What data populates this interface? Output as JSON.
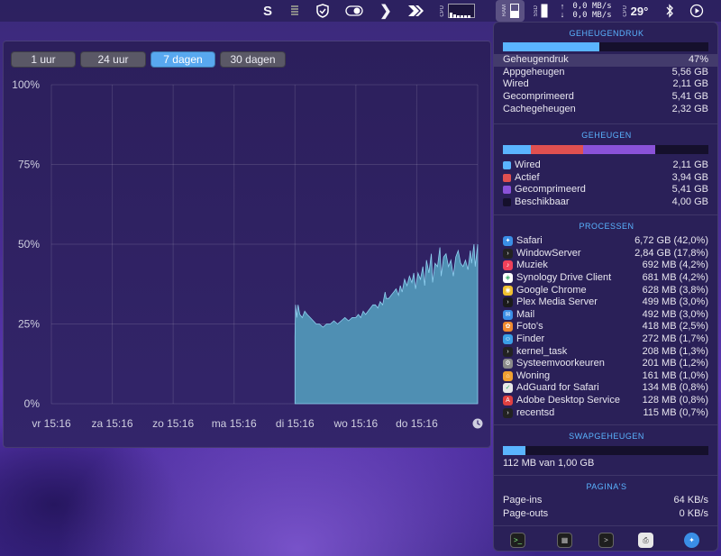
{
  "menubar": {
    "net_up": "0,0 MB/s",
    "net_down": "0,0 MB/s",
    "temperature": "29°"
  },
  "chart_window": {
    "ranges": [
      "1 uur",
      "24 uur",
      "7 dagen",
      "30 dagen"
    ],
    "selected_range": "7 dagen"
  },
  "chart_data": {
    "type": "area",
    "y_ticks": [
      "100%",
      "75%",
      "50%",
      "25%",
      "0%"
    ],
    "x_ticks": [
      "vr 15:16",
      "za 15:16",
      "zo 15:16",
      "ma 15:16",
      "di 15:16",
      "wo 15:16",
      "do 15:16"
    ],
    "ylim": [
      0,
      100
    ],
    "x_range_days": [
      0,
      7
    ],
    "series": [
      {
        "color": "#4f8fb3",
        "points": [
          [
            4.0,
            0
          ],
          [
            4.0,
            21
          ],
          [
            4.01,
            31
          ],
          [
            4.03,
            27
          ],
          [
            4.05,
            31
          ],
          [
            4.08,
            28
          ],
          [
            4.12,
            27
          ],
          [
            4.16,
            29
          ],
          [
            4.2,
            28
          ],
          [
            4.25,
            27
          ],
          [
            4.3,
            26
          ],
          [
            4.35,
            25
          ],
          [
            4.4,
            25
          ],
          [
            4.46,
            24
          ],
          [
            4.52,
            25
          ],
          [
            4.58,
            25
          ],
          [
            4.64,
            26
          ],
          [
            4.7,
            25
          ],
          [
            4.76,
            26
          ],
          [
            4.82,
            27
          ],
          [
            4.88,
            26
          ],
          [
            4.94,
            27
          ],
          [
            5.0,
            27
          ],
          [
            5.04,
            28
          ],
          [
            5.08,
            27
          ],
          [
            5.12,
            29
          ],
          [
            5.16,
            28
          ],
          [
            5.2,
            29
          ],
          [
            5.24,
            30
          ],
          [
            5.28,
            31
          ],
          [
            5.32,
            31
          ],
          [
            5.36,
            30
          ],
          [
            5.4,
            32
          ],
          [
            5.44,
            31
          ],
          [
            5.48,
            35
          ],
          [
            5.5,
            33
          ],
          [
            5.54,
            33
          ],
          [
            5.58,
            34
          ],
          [
            5.62,
            35
          ],
          [
            5.66,
            36
          ],
          [
            5.7,
            34
          ],
          [
            5.73,
            37
          ],
          [
            5.76,
            35
          ],
          [
            5.8,
            39
          ],
          [
            5.84,
            37
          ],
          [
            5.88,
            40
          ],
          [
            5.92,
            38
          ],
          [
            5.95,
            41
          ],
          [
            5.98,
            36
          ],
          [
            6.02,
            41
          ],
          [
            6.06,
            39
          ],
          [
            6.1,
            43
          ],
          [
            6.13,
            37
          ],
          [
            6.16,
            45
          ],
          [
            6.2,
            41
          ],
          [
            6.24,
            47
          ],
          [
            6.26,
            38
          ],
          [
            6.3,
            44
          ],
          [
            6.34,
            43
          ],
          [
            6.38,
            49
          ],
          [
            6.4,
            40
          ],
          [
            6.44,
            46
          ],
          [
            6.48,
            47
          ],
          [
            6.52,
            43
          ],
          [
            6.56,
            45
          ],
          [
            6.6,
            40
          ],
          [
            6.64,
            46
          ],
          [
            6.68,
            48
          ],
          [
            6.72,
            44
          ],
          [
            6.76,
            43
          ],
          [
            6.8,
            45
          ],
          [
            6.84,
            42
          ],
          [
            6.88,
            48
          ],
          [
            6.9,
            44
          ],
          [
            6.94,
            50
          ],
          [
            6.96,
            43
          ],
          [
            7.0,
            50
          ],
          [
            7.0,
            0
          ]
        ]
      }
    ]
  },
  "panel": {
    "sections": {
      "pressure": "GEHEUGENDRUK",
      "memory": "GEHEUGEN",
      "processes": "PROCESSEN",
      "swap": "SWAPGEHEUGEN",
      "pages": "PAGINA'S"
    },
    "pressure_bar": {
      "fraction": 0.47,
      "color": "#5ab4ff"
    },
    "pressure_rows": [
      {
        "label": "Geheugendruk",
        "value": "47%"
      },
      {
        "label": "Appgeheugen",
        "value": "5,56 GB"
      },
      {
        "label": "Wired",
        "value": "2,11 GB"
      },
      {
        "label": "Gecomprimeerd",
        "value": "5,41 GB"
      },
      {
        "label": "Cachegeheugen",
        "value": "2,32 GB"
      }
    ],
    "memory_rows": [
      {
        "label": "Wired",
        "value": "2,11 GB",
        "color": "#5ab4ff",
        "gb": 2.11
      },
      {
        "label": "Actief",
        "value": "3,94 GB",
        "color": "#e05050",
        "gb": 3.94
      },
      {
        "label": "Gecomprimeerd",
        "value": "5,41 GB",
        "color": "#8a52d8",
        "gb": 5.41
      },
      {
        "label": "Beschikbaar",
        "value": "4,00 GB",
        "color": "#15102c",
        "gb": 4.0
      }
    ],
    "processes": [
      {
        "name": "Safari",
        "value": "6,72 GB (42,0%)",
        "icon": "compass-icon",
        "color": "#3a8ee6"
      },
      {
        "name": "WindowServer",
        "value": "2,84 GB (17,8%)",
        "icon": "terminal-icon",
        "color": "#222"
      },
      {
        "name": "Muziek",
        "value": "692 MB (4,2%)",
        "icon": "music-icon",
        "color": "#f0405a"
      },
      {
        "name": "Synology Drive Client",
        "value": "681 MB (4,2%)",
        "icon": "drive-icon",
        "color": "#ffffff"
      },
      {
        "name": "Google Chrome",
        "value": "628 MB (3,8%)",
        "icon": "chrome-icon",
        "color": "#f0c030"
      },
      {
        "name": "Plex Media Server",
        "value": "499 MB (3,0%)",
        "icon": "plex-icon",
        "color": "#1a1a1a"
      },
      {
        "name": "Mail",
        "value": "492 MB (3,0%)",
        "icon": "mail-icon",
        "color": "#3a8ee6"
      },
      {
        "name": "Foto's",
        "value": "418 MB (2,5%)",
        "icon": "photos-icon",
        "color": "#f08a30"
      },
      {
        "name": "Finder",
        "value": "272 MB (1,7%)",
        "icon": "finder-icon",
        "color": "#3a9ee6"
      },
      {
        "name": "kernel_task",
        "value": "208 MB (1,3%)",
        "icon": "terminal-icon",
        "color": "#222"
      },
      {
        "name": "Systeemvoorkeuren",
        "value": "201 MB (1,2%)",
        "icon": "gear-icon",
        "color": "#8a8a8a"
      },
      {
        "name": "Woning",
        "value": "161 MB (1,0%)",
        "icon": "home-icon",
        "color": "#f0a030"
      },
      {
        "name": "AdGuard for Safari",
        "value": "134 MB (0,8%)",
        "icon": "shield-icon",
        "color": "#e8e8e8"
      },
      {
        "name": "Adobe Desktop Service",
        "value": "128 MB (0,8%)",
        "icon": "adobe-icon",
        "color": "#e04040"
      },
      {
        "name": "recentsd",
        "value": "115 MB (0,7%)",
        "icon": "terminal-icon",
        "color": "#222"
      }
    ],
    "swap_bar": {
      "fraction": 0.11,
      "color": "#5ab4ff"
    },
    "swap_text": "112 MB van 1,00 GB",
    "pages_rows": [
      {
        "label": "Page-ins",
        "value": "64 KB/s"
      },
      {
        "label": "Page-outs",
        "value": "0 KB/s"
      }
    ],
    "footer_icons": [
      "terminal-icon",
      "activity-monitor-icon",
      "console-icon",
      "printer-icon",
      "safari-icon"
    ]
  }
}
